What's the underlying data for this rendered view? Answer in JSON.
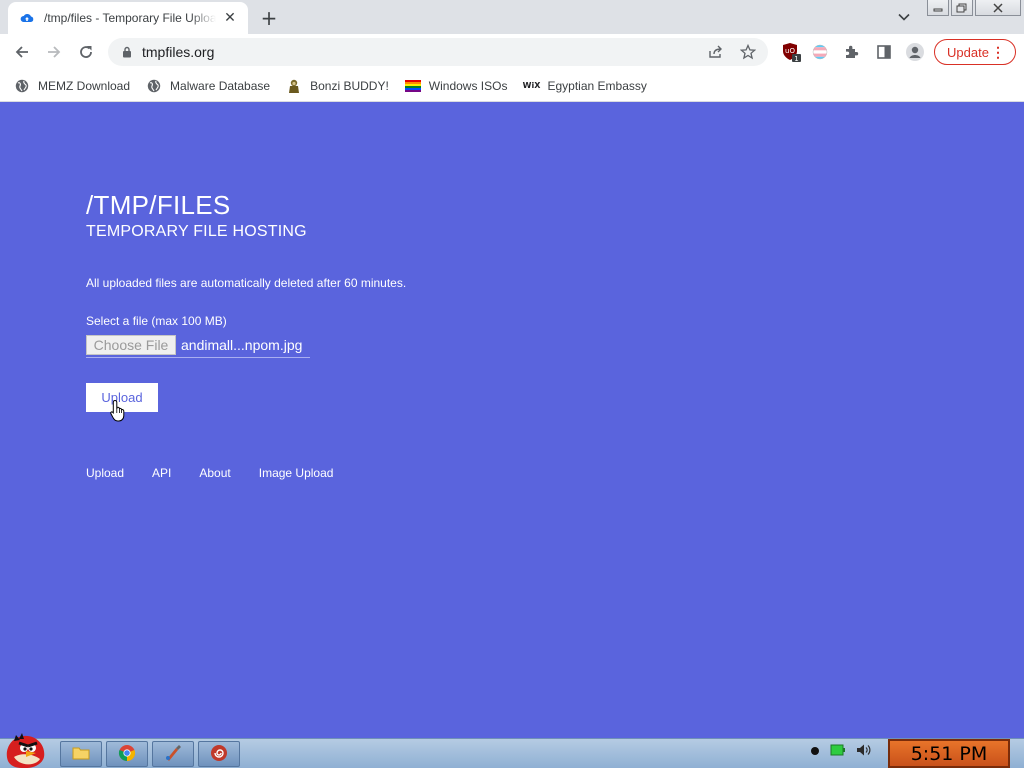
{
  "browser": {
    "tab_title": "/tmp/files - Temporary File Upload",
    "url": "tmpfiles.org",
    "update_label": "Update",
    "extension_badge": "1"
  },
  "bookmarks": [
    {
      "label": "MEMZ Download",
      "icon": "globe-icon"
    },
    {
      "label": "Malware Database",
      "icon": "globe-icon"
    },
    {
      "label": "Bonzi BUDDY!",
      "icon": "bonzi-icon"
    },
    {
      "label": "Windows ISOs",
      "icon": "rainbow-flag-icon"
    },
    {
      "label": "Egyptian Embassy",
      "icon": "wix-icon",
      "icon_text": "WiX"
    }
  ],
  "page": {
    "title": "/TMP/FILES",
    "subtitle": "TEMPORARY FILE HOSTING",
    "notice": "All uploaded files are automatically deleted after 60 minutes.",
    "select_label": "Select a file (max 100 MB)",
    "choose_button": "Choose File",
    "filename": "andimall...npom.jpg",
    "upload_button": "Upload",
    "footer_links": [
      "Upload",
      "API",
      "About",
      "Image Upload"
    ]
  },
  "taskbar": {
    "clock": "5:51 PM"
  },
  "colors": {
    "page_bg": "#5a64dd",
    "update_red": "#d93025",
    "clock_bg": "#e8742a"
  }
}
